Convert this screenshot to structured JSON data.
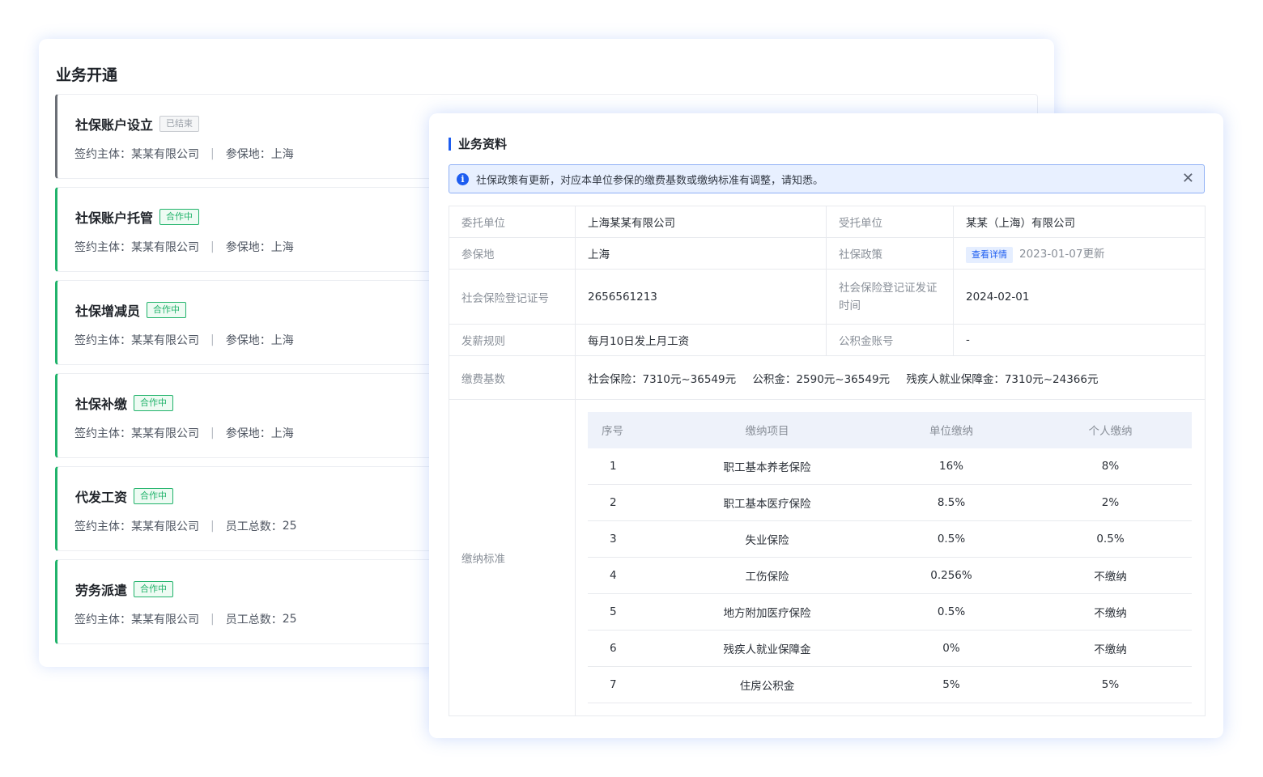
{
  "back_panel": {
    "title": "业务开通",
    "items": [
      {
        "name": "社保账户设立",
        "tag": "已结束",
        "status": "ended",
        "meta1_label": "签约主体",
        "meta1_value": "某某有限公司",
        "meta2_label": "参保地",
        "meta2_value": "上海"
      },
      {
        "name": "社保账户托管",
        "tag": "合作中",
        "status": "active",
        "meta1_label": "签约主体",
        "meta1_value": "某某有限公司",
        "meta2_label": "参保地",
        "meta2_value": "上海"
      },
      {
        "name": "社保增减员",
        "tag": "合作中",
        "status": "active",
        "meta1_label": "签约主体",
        "meta1_value": "某某有限公司",
        "meta2_label": "参保地",
        "meta2_value": "上海"
      },
      {
        "name": "社保补缴",
        "tag": "合作中",
        "status": "active",
        "meta1_label": "签约主体",
        "meta1_value": "某某有限公司",
        "meta2_label": "参保地",
        "meta2_value": "上海"
      },
      {
        "name": "代发工资",
        "tag": "合作中",
        "status": "active",
        "meta1_label": "签约主体",
        "meta1_value": "某某有限公司",
        "meta2_label": "员工总数",
        "meta2_value": "25"
      },
      {
        "name": "劳务派遣",
        "tag": "合作中",
        "status": "active",
        "meta1_label": "签约主体",
        "meta1_value": "某某有限公司",
        "meta2_label": "员工总数",
        "meta2_value": "25"
      }
    ]
  },
  "front_panel": {
    "title": "业务资料",
    "alert": {
      "icon": "info-icon",
      "text": "社保政策有更新，对应本单位参保的缴费基数或缴纳标准有调整，请知悉。",
      "close_icon": "close-icon"
    },
    "info": {
      "entrust_label": "委托单位",
      "entrust_value": "上海某某有限公司",
      "trustee_label": "受托单位",
      "trustee_value": "某某（上海）有限公司",
      "location_label": "参保地",
      "location_value": "上海",
      "policy_label": "社保政策",
      "policy_link": "查看详情",
      "policy_updated": "2023-01-07更新",
      "reg_no_label": "社会保险登记证号",
      "reg_no_value": "2656561213",
      "issue_label": "社会保险登记证发证时间",
      "issue_value": "2024-02-01",
      "payroll_label": "发薪规则",
      "payroll_value": "每月10日发上月工资",
      "fund_label": "公积金账号",
      "fund_value": "-",
      "base_label": "缴费基数",
      "base_items": [
        "社会保险：7310元~36549元",
        "公积金：2590元~36549元",
        "残疾人就业保障金：7310元~24366元"
      ],
      "standard_label": "缴纳标准"
    },
    "standards": {
      "headers": [
        "序号",
        "缴纳项目",
        "单位缴纳",
        "个人缴纳"
      ],
      "rows": [
        [
          "1",
          "职工基本养老保险",
          "16%",
          "8%"
        ],
        [
          "2",
          "职工基本医疗保险",
          "8.5%",
          "2%"
        ],
        [
          "3",
          "失业保险",
          "0.5%",
          "0.5%"
        ],
        [
          "4",
          "工伤保险",
          "0.256%",
          "不缴纳"
        ],
        [
          "5",
          "地方附加医疗保险",
          "0.5%",
          "不缴纳"
        ],
        [
          "6",
          "残疾人就业保障金",
          "0%",
          "不缴纳"
        ],
        [
          "7",
          "住房公积金",
          "5%",
          "5%"
        ]
      ]
    }
  }
}
